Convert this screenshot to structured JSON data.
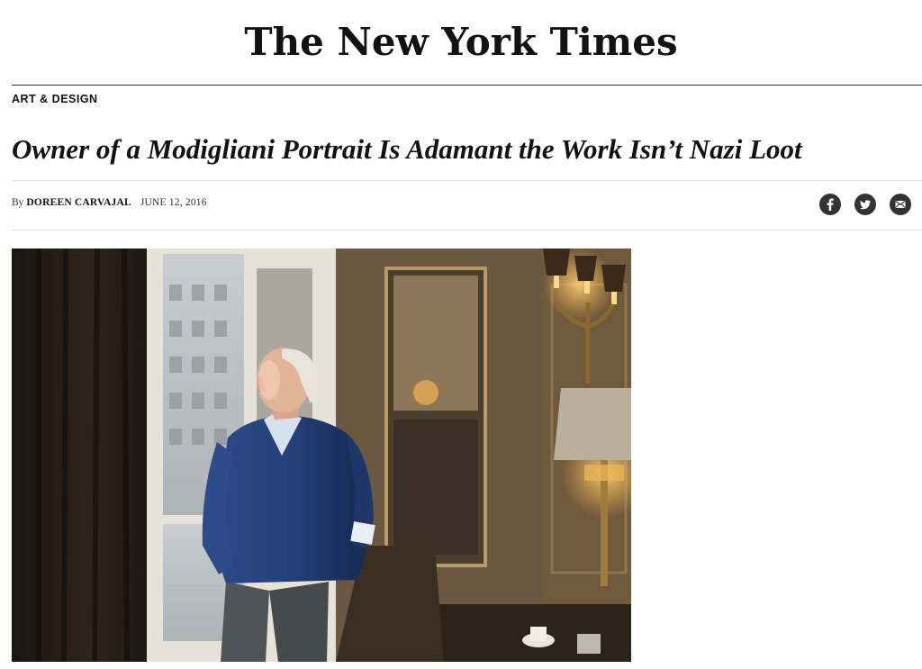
{
  "masthead": {
    "logo_text": "The New York Times"
  },
  "section": {
    "label": "ART & DESIGN"
  },
  "article": {
    "headline": "Owner of a Modigliani Portrait Is Adamant the Work Isn’t Nazi Loot",
    "byline_prefix": "By",
    "author": "DOREEN CARVAJAL",
    "date": "JUNE 12, 2016"
  },
  "share": {
    "icons": [
      "facebook-icon",
      "twitter-icon",
      "email-icon"
    ]
  },
  "photo": {
    "subject": "man-standing-by-window-photo"
  },
  "colors": {
    "text": "#121212",
    "share_icon_bg": "#333333",
    "rule": "#e2e2e2"
  }
}
